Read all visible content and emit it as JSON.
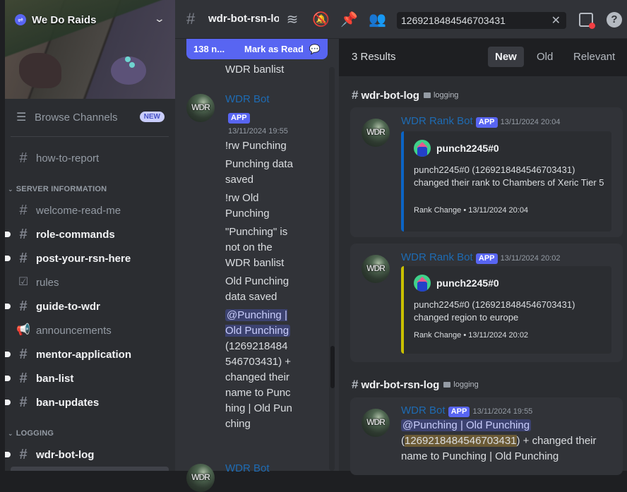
{
  "server": {
    "name": "We Do Raids",
    "browse_label": "Browse Channels",
    "new_badge": "NEW"
  },
  "sidebar": {
    "top_channels": [
      {
        "name": "how-to-report",
        "icon": "hash-icon",
        "unread": false
      }
    ],
    "categories": [
      {
        "name": "SERVER INFORMATION",
        "channels": [
          {
            "name": "welcome-read-me",
            "icon": "hash-icon",
            "unread": false
          },
          {
            "name": "role-commands",
            "icon": "hash-icon",
            "unread": true
          },
          {
            "name": "post-your-rsn-here",
            "icon": "hash-icon",
            "unread": true
          },
          {
            "name": "rules",
            "icon": "rules-icon",
            "unread": false
          },
          {
            "name": "guide-to-wdr",
            "icon": "locked-hash-icon",
            "unread": true
          },
          {
            "name": "announcements",
            "icon": "locked-announcement-icon",
            "unread": false
          },
          {
            "name": "mentor-application",
            "icon": "locked-hash-icon",
            "unread": true
          },
          {
            "name": "ban-list",
            "icon": "locked-hash-icon",
            "unread": true
          },
          {
            "name": "ban-updates",
            "icon": "locked-hash-icon",
            "unread": true
          }
        ]
      },
      {
        "name": "LOGGING",
        "channels": [
          {
            "name": "wdr-bot-log",
            "icon": "locked-hash-icon",
            "unread": true
          }
        ]
      }
    ]
  },
  "header": {
    "channel_name": "wdr-bot-rsn-log",
    "search_value": "1269218484546703431"
  },
  "chat": {
    "new_messages_label": "138 n...",
    "mark_as_read_label": "Mark as Read",
    "prev_tail": "WDR banlist",
    "message": {
      "author": "WDR Bot",
      "badge": "APP",
      "timestamp": "13/11/2024 19:55",
      "lines": [
        "!rw Punching",
        "Punching data saved",
        "!rw Old Punching",
        "\"Punching\" is not on the WDR banlist",
        "Old Punching data saved"
      ],
      "mention": "@Punching | Old Punching",
      "mention_tail": "(1269218484546703431) + changed their name to Punching | Old Punching"
    },
    "next_author": "WDR Bot"
  },
  "results": {
    "count_label": "3 Results",
    "sort_options": [
      "New",
      "Old",
      "Relevant"
    ],
    "active_sort": "New",
    "groups": [
      {
        "channel": "wdr-bot-log",
        "category": "logging",
        "messages": [
          {
            "author": "WDR Rank Bot",
            "badge": "APP",
            "timestamp": "13/11/2024 20:04",
            "embed": {
              "color": "#0b64c5",
              "user": "punch2245#0",
              "description": "punch2245#0 (1269218484546703431) changed their rank to Chambers of Xeric Tier 5",
              "footer": "Rank Change • 13/11/2024 20:04"
            }
          },
          {
            "author": "WDR Rank Bot",
            "badge": "APP",
            "timestamp": "13/11/2024 20:02",
            "embed": {
              "color": "#c9c000",
              "user": "punch2245#0",
              "description": "punch2245#0 (1269218484546703431) changed region to europe",
              "footer": "Rank Change • 13/11/2024 20:02"
            }
          }
        ]
      },
      {
        "channel": "wdr-bot-rsn-log",
        "category": "logging",
        "messages": [
          {
            "author": "WDR Bot",
            "badge": "APP",
            "timestamp": "13/11/2024 19:55",
            "mention": "@Punching | Old Punching",
            "text_pre": "(",
            "highlight": "1269218484546703431",
            "text_post": ") + changed their name to Punching | Old Punching"
          }
        ]
      }
    ]
  },
  "avatar_text": "WDR"
}
